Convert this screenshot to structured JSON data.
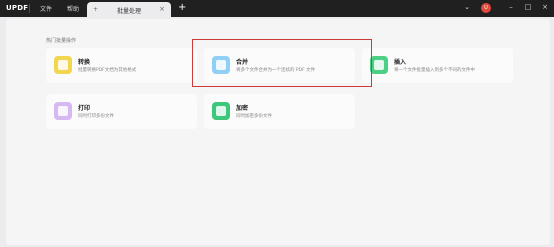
{
  "titlebar": {
    "logo": "UPDF",
    "menu": [
      "文件",
      "帮助"
    ],
    "tab_label": "批量处理",
    "tab_icon": "+",
    "tab_close": "×",
    "add_tab": "+",
    "avatar_letter": "U",
    "window_controls": [
      "⌄",
      "–",
      "□",
      "×"
    ]
  },
  "main": {
    "section_title": "热门批量操作",
    "cards": [
      {
        "title": "转换",
        "desc": "批量转换PDF文档为其他格式",
        "icon": "convert-icon",
        "color": "#f2d64f"
      },
      {
        "title": "合并",
        "desc": "将多个文件合并为一个连续的 PDF 文件",
        "icon": "merge-icon",
        "color": "#8fd0f4"
      },
      {
        "title": "插入",
        "desc": "将一个文件批量插入到多个不同的文件中",
        "icon": "insert-icon",
        "color": "#4fcf86"
      },
      {
        "title": "打印",
        "desc": "同时打印多份文件",
        "icon": "print-icon",
        "color": "#d6b8f2"
      },
      {
        "title": "加密",
        "desc": "同时加密多份文件",
        "icon": "lock-icon",
        "color": "#3dc77a"
      }
    ]
  }
}
